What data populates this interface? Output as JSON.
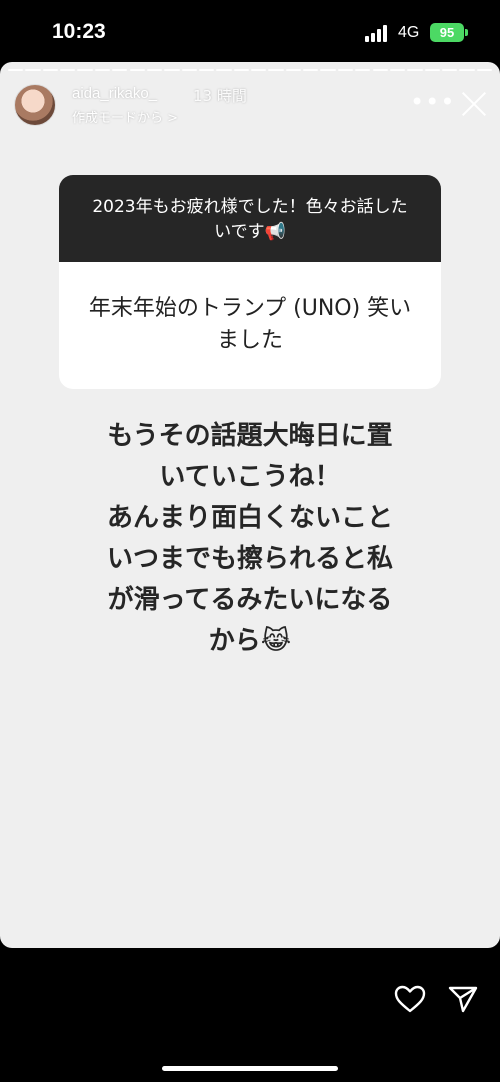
{
  "status_bar": {
    "time": "10:23",
    "network": "4G",
    "battery": "95"
  },
  "story": {
    "username": "aida_rikako_",
    "time_ago": "13 時間",
    "mode_link": "作成モードから >",
    "question": {
      "prompt": "2023年もお疲れ様でした！色々お話したいです📢",
      "answer": "年末年始のトランプ (UNO) 笑いました"
    },
    "reply_lines": [
      "もうその話題大晦日に置",
      "いていこうね！",
      "あんまり面白くないこと",
      "いつまでも擦られると私",
      "が滑ってるみたいになる",
      "から😹"
    ]
  },
  "colors": {
    "story_bg": "#efefef",
    "question_header": "#262626",
    "battery": "#4cd964"
  }
}
